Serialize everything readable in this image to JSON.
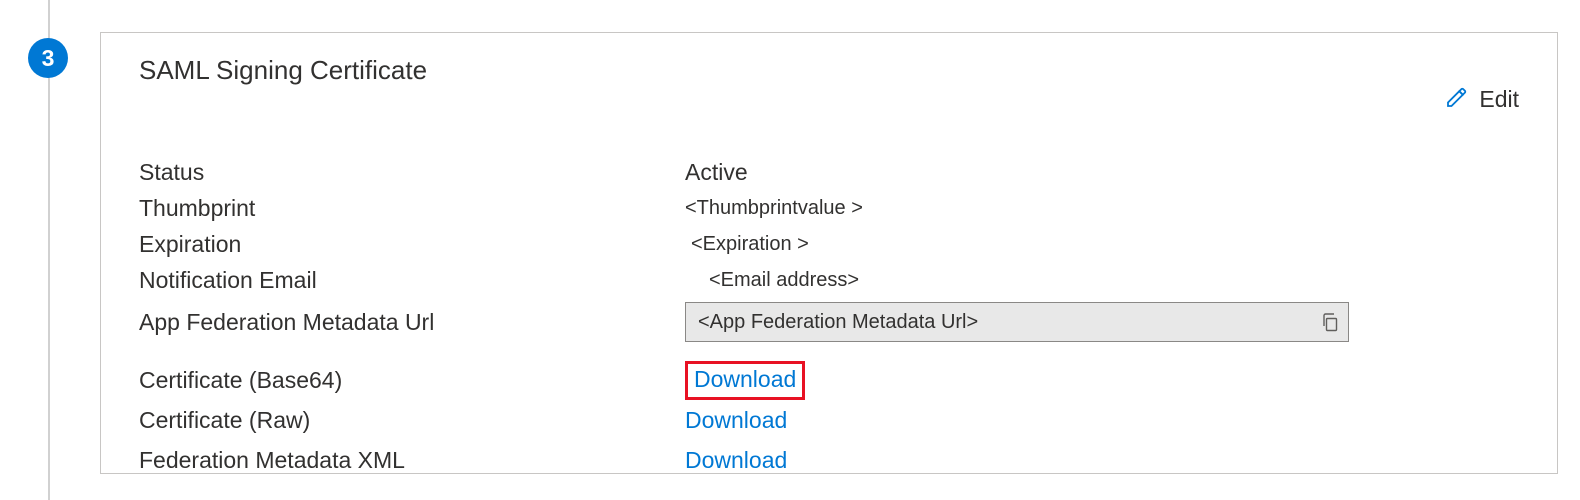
{
  "step": {
    "number": "3"
  },
  "card": {
    "title": "SAML Signing Certificate",
    "edit_label": "Edit"
  },
  "fields": {
    "status": {
      "label": "Status",
      "value": "Active"
    },
    "thumbprint": {
      "label": "Thumbprint",
      "value": "<Thumbprintvalue >"
    },
    "expiration": {
      "label": "Expiration",
      "value": "<Expiration >"
    },
    "notification_email": {
      "label": "Notification Email",
      "value": "<Email address>"
    },
    "metadata_url": {
      "label": "App Federation Metadata Url",
      "value": "<App Federation Metadata Url>"
    }
  },
  "downloads": {
    "cert_base64": {
      "label": "Certificate (Base64)",
      "link": "Download"
    },
    "cert_raw": {
      "label": "Certificate (Raw)",
      "link": "Download"
    },
    "fed_xml": {
      "label": "Federation Metadata XML",
      "link": "Download"
    }
  }
}
